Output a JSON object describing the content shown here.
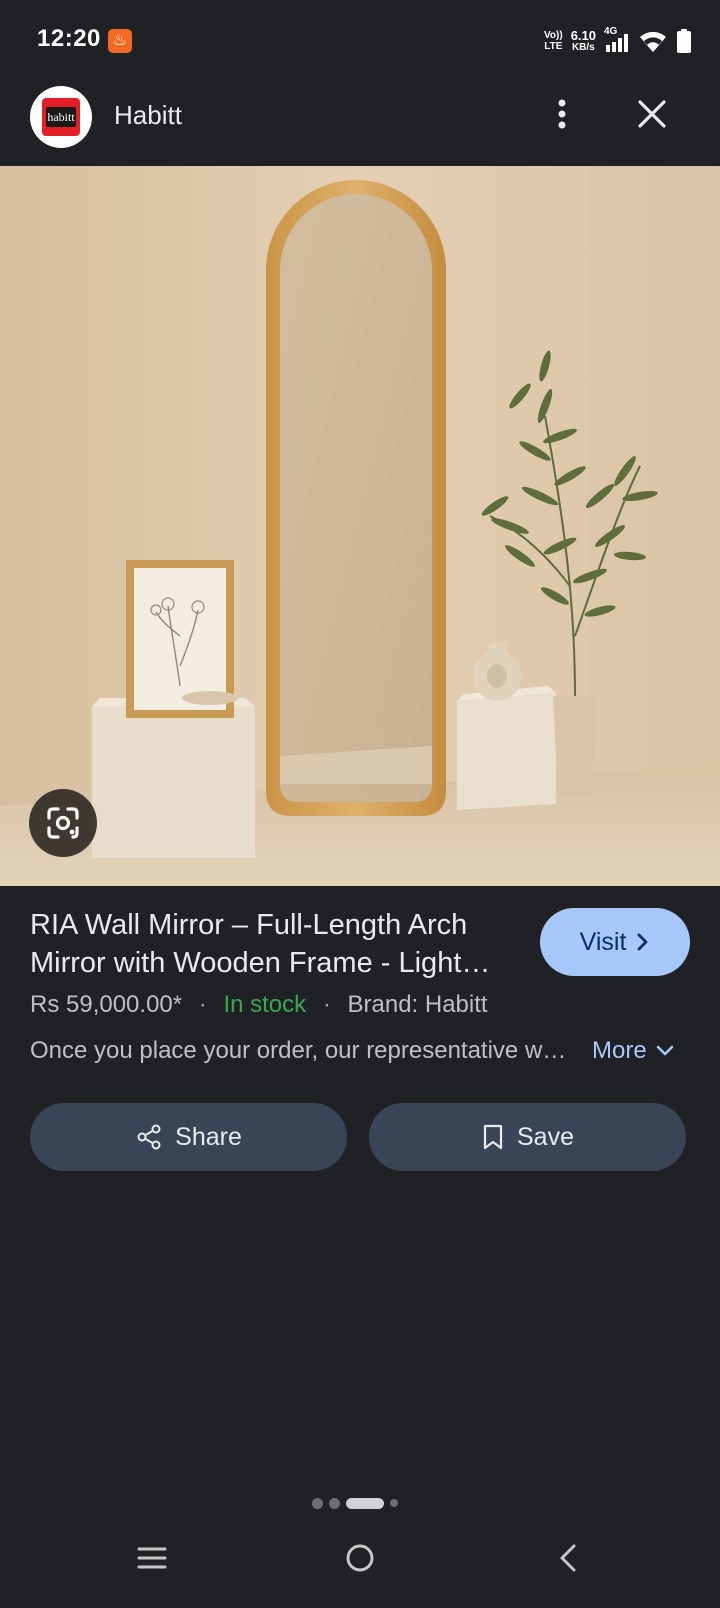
{
  "status_bar": {
    "time": "12:20",
    "network_top": "Vo))",
    "network_bottom": "LTE",
    "speed_value": "6.10",
    "speed_unit": "KB/s",
    "network_type": "4G"
  },
  "header": {
    "site_name": "Habitt",
    "logo_text": "habitt"
  },
  "product": {
    "title": "RIA Wall Mirror – Full-Length Arch Mirror with Wooden Frame - Light Oak Finish",
    "price": "Rs 59,000.00*",
    "separator": "·",
    "stock": "In stock",
    "brand": "Brand: Habitt",
    "description": "Once you place your order, our representative will contact you",
    "more_label": "More"
  },
  "buttons": {
    "visit_label": "Visit",
    "share_label": "Share",
    "save_label": "Save"
  },
  "colors": {
    "background": "#202124",
    "visit_button": "#a8c7fa",
    "action_button": "#394457",
    "stock_green": "#34a853",
    "link_blue": "#a8c7fa"
  },
  "pager": {
    "total": 4,
    "active_index": 2
  },
  "icons": {
    "more": "more-vert-icon",
    "close": "close-icon",
    "lens": "google-lens-icon",
    "share": "share-icon",
    "save": "bookmark-icon",
    "visit": "chevron-right-icon",
    "expand": "chevron-down-icon"
  }
}
